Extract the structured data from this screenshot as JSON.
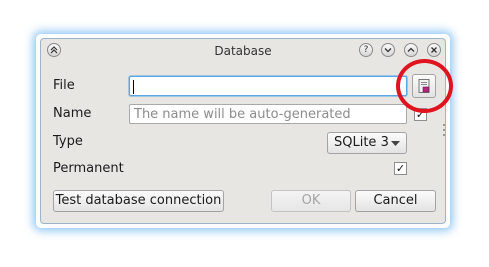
{
  "window": {
    "title": "Database"
  },
  "titlebar_buttons": {
    "left": "⌃",
    "help": "?",
    "minimize": "⌄",
    "maximize": "⌃",
    "close": "✕"
  },
  "form": {
    "file_label": "File",
    "file_value": "",
    "name_label": "Name",
    "name_placeholder": "The name will be auto-generated",
    "type_label": "Type",
    "type_selected": "SQLite 3",
    "permanent_label": "Permanent",
    "permanent_checked": true,
    "check_mark": "✓"
  },
  "buttons": {
    "test_connection": "Test database connection",
    "ok": "OK",
    "cancel": "Cancel"
  },
  "colors": {
    "highlight_circle": "#e0141e",
    "focus_border": "#58a6e6"
  }
}
